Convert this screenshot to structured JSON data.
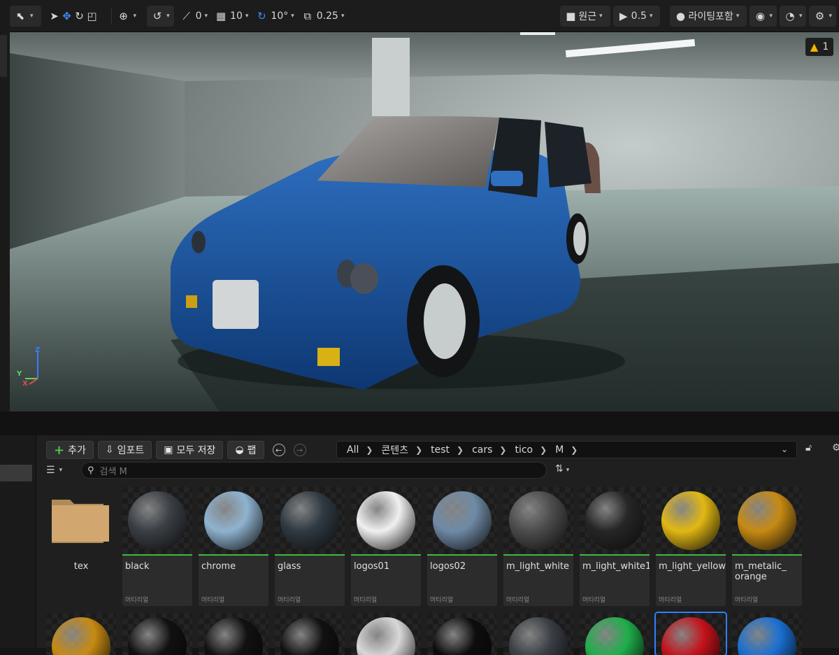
{
  "toolbar": {
    "grid_snap": "10",
    "rotation_snap": "10°",
    "scale_snap": "0.25",
    "transform_value": "0",
    "camera_mode": "원근",
    "camera_speed": "0.5",
    "view_mode": "라이팅포함",
    "warnings_count": "1"
  },
  "content_browser": {
    "add_label": "추가",
    "import_label": "임포트",
    "save_all_label": "모두 저장",
    "fab_label": "팹",
    "path": [
      "All",
      "콘텐츠",
      "test",
      "cars",
      "tico",
      "M"
    ],
    "search_placeholder": "검색 M",
    "folder": {
      "name": "tex"
    },
    "assets_row1": [
      {
        "name": "black",
        "type": "머티리얼",
        "color": "#3a3f45"
      },
      {
        "name": "chrome",
        "type": "머티리얼",
        "color": "#8fb3cf"
      },
      {
        "name": "glass",
        "type": "머티리얼",
        "color": "#2f3a42"
      },
      {
        "name": "logos01",
        "type": "머티리얼",
        "color": "#f0f0f0"
      },
      {
        "name": "logos02",
        "type": "머티리얼",
        "color": "#6f8aa6"
      },
      {
        "name": "m_light_white",
        "type": "머티리얼",
        "color": "#4c4c4c"
      },
      {
        "name": "m_light_white1",
        "type": "머티리얼",
        "color": "#262626"
      },
      {
        "name": "m_light_yellow",
        "type": "머티리얼",
        "color": "#e2b813"
      },
      {
        "name": "m_metalic_ orange",
        "type": "머티리얼",
        "color": "#c78a12"
      }
    ],
    "assets_row2_colors": [
      "#c78a12",
      "#111111",
      "#111111",
      "#111111",
      "#d8d8d8",
      "#0d0d0d",
      "#3a3f45",
      "#1fae4a",
      "#c4121a",
      "#1a6fd1"
    ]
  }
}
